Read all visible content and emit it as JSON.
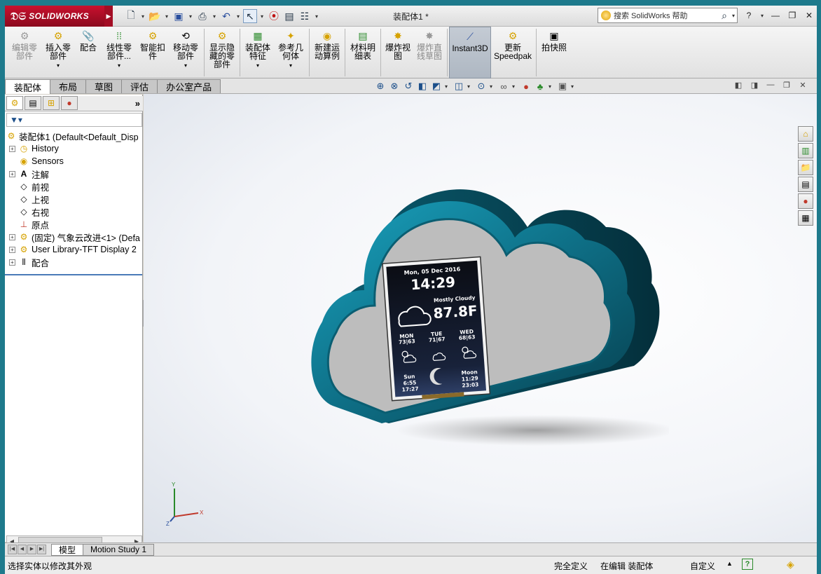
{
  "app": {
    "brand": "SOLIDWORKS",
    "document_title": "装配体1 *",
    "help_search_placeholder": "搜索 SolidWorks 帮助"
  },
  "colors": {
    "brand_red": "#c8102e",
    "frame_teal": "#1e7a8c",
    "model_shell": "#0e6f86",
    "model_face": "#bdbdbd",
    "highlight_blue": "#4a7ab8"
  },
  "quick_toolbar": [
    {
      "name": "new-file",
      "icon": "new-document-icon"
    },
    {
      "name": "open-file",
      "icon": "folder-open-icon"
    },
    {
      "name": "save",
      "icon": "save-icon"
    },
    {
      "name": "print",
      "icon": "printer-icon"
    },
    {
      "name": "undo",
      "icon": "undo-icon"
    },
    {
      "name": "select",
      "icon": "cursor-icon"
    },
    {
      "name": "rebuild",
      "icon": "traffic-light-icon"
    },
    {
      "name": "file-properties",
      "icon": "properties-icon"
    },
    {
      "name": "options",
      "icon": "options-icon"
    }
  ],
  "commands": [
    {
      "line1": "编辑零",
      "line2": "部件",
      "disabled": true,
      "icon": "edit-component-icon"
    },
    {
      "line1": "插入零",
      "line2": "部件",
      "has_menu": true,
      "icon": "insert-component-icon"
    },
    {
      "line1": "配合",
      "line2": "",
      "icon": "mate-icon"
    },
    {
      "line1": "线性零",
      "line2": "部件...",
      "has_menu": true,
      "icon": "linear-pattern-icon"
    },
    {
      "line1": "智能扣",
      "line2": "件",
      "icon": "smart-fasteners-icon"
    },
    {
      "line1": "移动零",
      "line2": "部件",
      "has_menu": true,
      "icon": "move-component-icon"
    },
    {
      "line1": "显示隐",
      "line2": "藏的零",
      "line3": "部件",
      "icon": "show-hidden-icon"
    },
    {
      "line1": "装配体",
      "line2": "特征",
      "has_menu": true,
      "icon": "assembly-features-icon"
    },
    {
      "line1": "参考几",
      "line2": "何体",
      "has_menu": true,
      "icon": "reference-geometry-icon"
    },
    {
      "line1": "新建运",
      "line2": "动算例",
      "icon": "motion-study-icon"
    },
    {
      "line1": "材料明",
      "line2": "细表",
      "icon": "bill-of-materials-icon"
    },
    {
      "line1": "爆炸视",
      "line2": "图",
      "icon": "exploded-view-icon"
    },
    {
      "line1": "爆炸直",
      "line2": "线草图",
      "disabled": true,
      "icon": "explode-line-icon"
    },
    {
      "line1": "Instant3D",
      "line2": "",
      "active": true,
      "icon": "instant3d-icon"
    },
    {
      "line1": "更新",
      "line2": "Speedpak",
      "icon": "speedpak-icon"
    },
    {
      "line1": "拍快照",
      "line2": "",
      "icon": "snapshot-icon"
    }
  ],
  "tabs": [
    "装配体",
    "布局",
    "草图",
    "评估",
    "办公室产品"
  ],
  "feature_tree": {
    "root": "装配体1  (Default<Default_Disp",
    "nodes": [
      {
        "label": "History",
        "expandable": true,
        "icon": "history-icon"
      },
      {
        "label": "Sensors",
        "expandable": false,
        "icon": "sensor-icon"
      },
      {
        "label": "注解",
        "expandable": true,
        "icon": "annotation-icon"
      },
      {
        "label": "前视",
        "expandable": false,
        "icon": "plane-icon"
      },
      {
        "label": "上视",
        "expandable": false,
        "icon": "plane-icon"
      },
      {
        "label": "右视",
        "expandable": false,
        "icon": "plane-icon"
      },
      {
        "label": "原点",
        "expandable": false,
        "icon": "origin-icon"
      },
      {
        "label": "(固定) 气象云改进<1> (Defa",
        "expandable": true,
        "icon": "part-icon"
      },
      {
        "label": "User Library-TFT Display 2",
        "expandable": true,
        "icon": "part-icon"
      },
      {
        "label": "配合",
        "expandable": true,
        "icon": "mates-folder-icon"
      }
    ]
  },
  "display": {
    "date": "Mon, 05 Dec 2016",
    "time": "14:29",
    "condition": "Mostly Cloudy",
    "temperature": "87.8F",
    "forecast": [
      {
        "day": "MON",
        "temps": "73|63"
      },
      {
        "day": "TUE",
        "temps": "71|67"
      },
      {
        "day": "WED",
        "temps": "68|63"
      }
    ],
    "sun_label": "Sun",
    "sun_rise": "6:55",
    "sun_set": "17:27",
    "moon_label": "Moon",
    "moon_rise": "11:29",
    "moon_set": "23:03"
  },
  "triad": {
    "x": "X",
    "y": "Y",
    "z": "Z"
  },
  "bottom_tabs": [
    "模型",
    "Motion Study 1"
  ],
  "status": {
    "hint": "选择实体以修改其外观",
    "definition": "完全定义",
    "editing": "在编辑 装配体",
    "units": "自定义"
  }
}
